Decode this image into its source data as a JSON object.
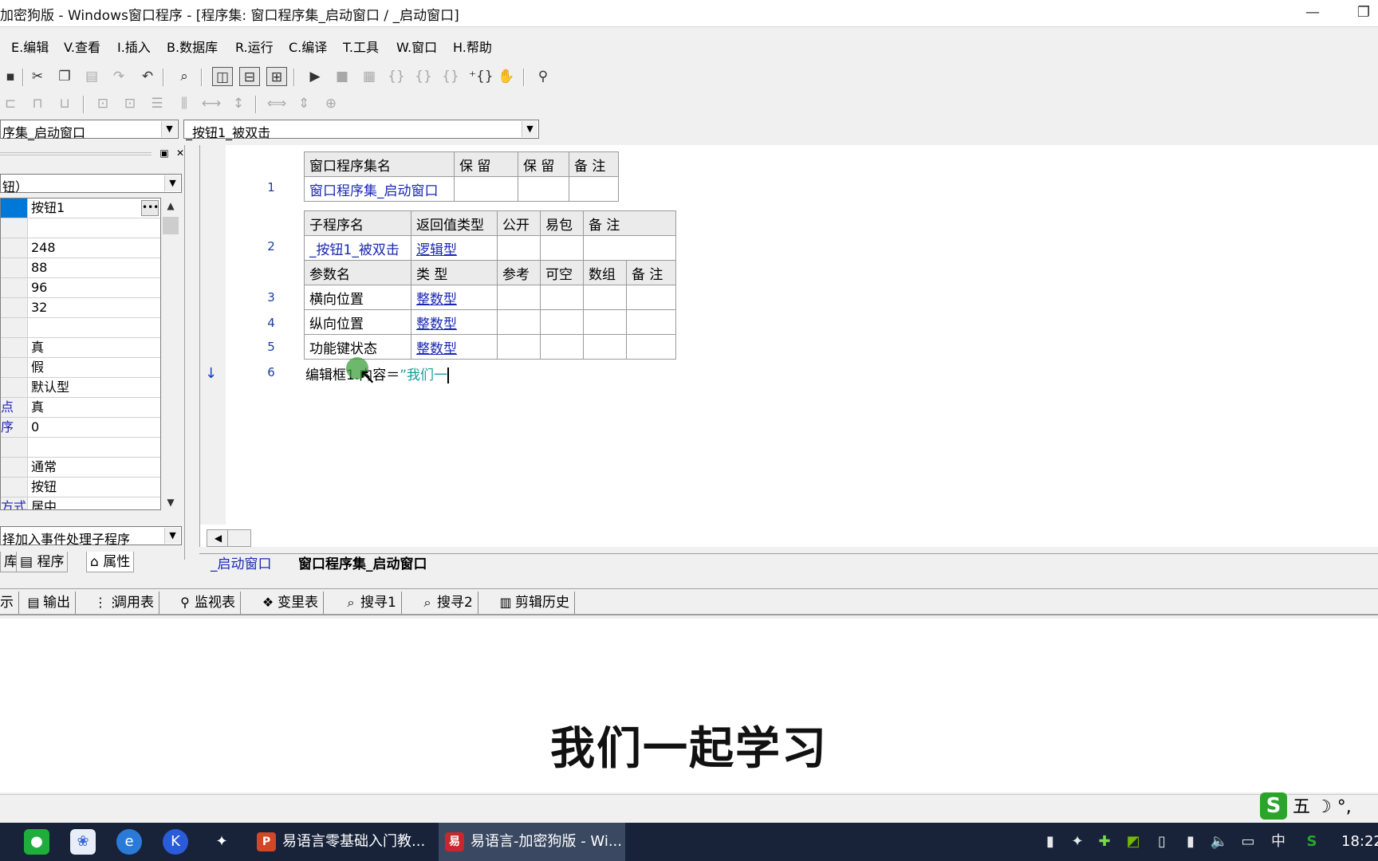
{
  "window": {
    "title": "加密狗版 - Windows窗口程序 - [程序集: 窗口程序集_启动窗口 / _启动窗口]",
    "minimize_glyph": "—",
    "restore_glyph": "❐"
  },
  "menu": [
    "E.编辑",
    "V.查看",
    "I.插入",
    "B.数据库",
    "R.运行",
    "C.编译",
    "T.工具",
    "W.窗口",
    "H.帮助"
  ],
  "combos": {
    "module": "序集_启动窗口",
    "subroutine": "_按钮1_被双击"
  },
  "left_panel": {
    "component_combo": "钮）",
    "properties": [
      {
        "name": "",
        "value": "按钮1"
      },
      {
        "name": "",
        "value": ""
      },
      {
        "name": "",
        "value": "248"
      },
      {
        "name": "",
        "value": "88"
      },
      {
        "name": "",
        "value": "96"
      },
      {
        "name": "",
        "value": "32"
      },
      {
        "name": "",
        "value": ""
      },
      {
        "name": "",
        "value": "真"
      },
      {
        "name": "",
        "value": "假"
      },
      {
        "name": "",
        "value": "默认型"
      },
      {
        "name": "点",
        "value": "真"
      },
      {
        "name": "序",
        "value": "0"
      },
      {
        "name": "",
        "value": ""
      },
      {
        "name": "",
        "value": "通常"
      },
      {
        "name": "",
        "value": "按钮"
      },
      {
        "name": "方式",
        "value": "居中"
      }
    ],
    "event_combo": "择加入事件处理子程序",
    "tabs": [
      "库",
      "程序",
      "属性"
    ]
  },
  "editor": {
    "assembly_table": {
      "headers": [
        "窗口程序集名",
        "保 留",
        "保 留",
        "备 注"
      ],
      "row": [
        "窗口程序集_启动窗口",
        "",
        "",
        ""
      ]
    },
    "sub_table": {
      "headers": [
        "子程序名",
        "返回值类型",
        "公开",
        "易包",
        "备 注"
      ],
      "row": [
        "_按钮1_被双击",
        "逻辑型",
        "",
        "",
        ""
      ],
      "param_headers": [
        "参数名",
        "类 型",
        "参考",
        "可空",
        "数组",
        "备 注"
      ],
      "params": [
        [
          "横向位置",
          "整数型"
        ],
        [
          "纵向位置",
          "整数型"
        ],
        [
          "功能键状态",
          "整数型"
        ]
      ]
    },
    "line_numbers": [
      "1",
      "2",
      "3",
      "4",
      "5",
      "6"
    ],
    "code_line": {
      "prefix": "编辑框1.内容＝",
      "string": "”我们一"
    },
    "arrow_glyph": "↓"
  },
  "editor_tabs": [
    "_启动窗口",
    "窗口程序集_启动窗口"
  ],
  "output_tabs": [
    {
      "icon": "output-icon",
      "label": "示"
    },
    {
      "icon": "output-icon",
      "label": "输出"
    },
    {
      "icon": "call-table-icon",
      "label": "调用表"
    },
    {
      "icon": "monitor-icon",
      "label": "监视表"
    },
    {
      "icon": "variable-icon",
      "label": "变里表"
    },
    {
      "icon": "search-icon",
      "label": "搜寻1"
    },
    {
      "icon": "search-icon",
      "label": "搜寻2"
    },
    {
      "icon": "clipboard-icon",
      "label": "剪辑历史"
    }
  ],
  "subtitle": "我们一起学习",
  "ime": {
    "mode": "五",
    "extras": "☽ °,"
  },
  "taskbar": {
    "tasks": [
      {
        "label": "易语言零基础入门教...",
        "icon_letter": "P",
        "icon_color": "#d24726"
      },
      {
        "label": "易语言-加密狗版 - Wi...",
        "icon_letter": "易",
        "icon_color": "#c8282d"
      }
    ],
    "tray_ime": "中",
    "clock": "18:22"
  }
}
